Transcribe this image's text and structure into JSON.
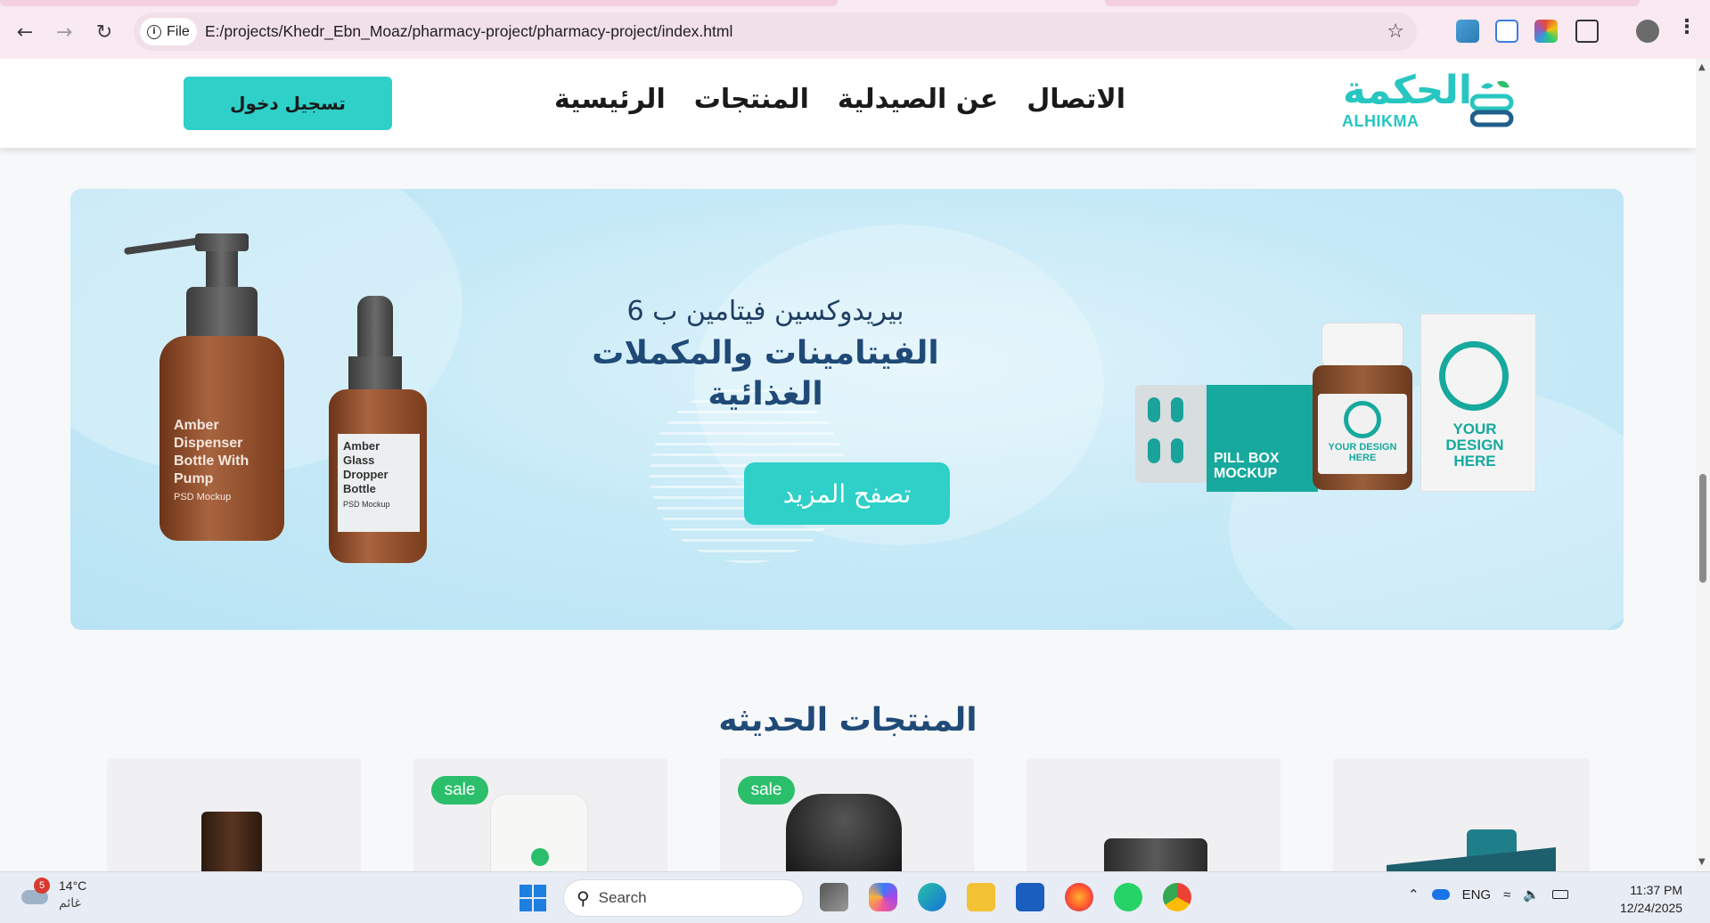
{
  "browser": {
    "chip_label": "File",
    "url": "E:/projects/Khedr_Ebn_Moaz/pharmacy-project/pharmacy-project/index.html"
  },
  "site": {
    "logo_ar": "الحكمة",
    "logo_en": "ALHIKMA",
    "nav": [
      "الرئيسية",
      "المنتجات",
      "عن الصيدلية",
      "الاتصال"
    ],
    "login_label": "تسجيل دخول"
  },
  "hero": {
    "subtitle": "بيريدوكسين فيتامين ب 6",
    "title": "الفيتامينات والمكملات الغذائية",
    "button_label": "تصفح المزيد",
    "bottle1_label": "Amber Dispenser Bottle With Pump",
    "bottle1_small": "PSD Mockup",
    "bottle2_label": "Amber Glass Dropper Bottle",
    "bottle2_small": "PSD Mockup",
    "pack_label1": "PILL BOX MOCKUP",
    "pack_label2": "YOUR DESIGN HERE",
    "pack_label3": "YOUR DESIGN HERE"
  },
  "products": {
    "section_title": "المنتجات الحديثه",
    "sale_label": "sale"
  },
  "taskbar": {
    "weather_badge": "5",
    "temperature": "14°C",
    "condition": "غائم",
    "search_label": "Search",
    "language": "ENG",
    "time": "11:37 PM",
    "date": "12/24/2025"
  }
}
